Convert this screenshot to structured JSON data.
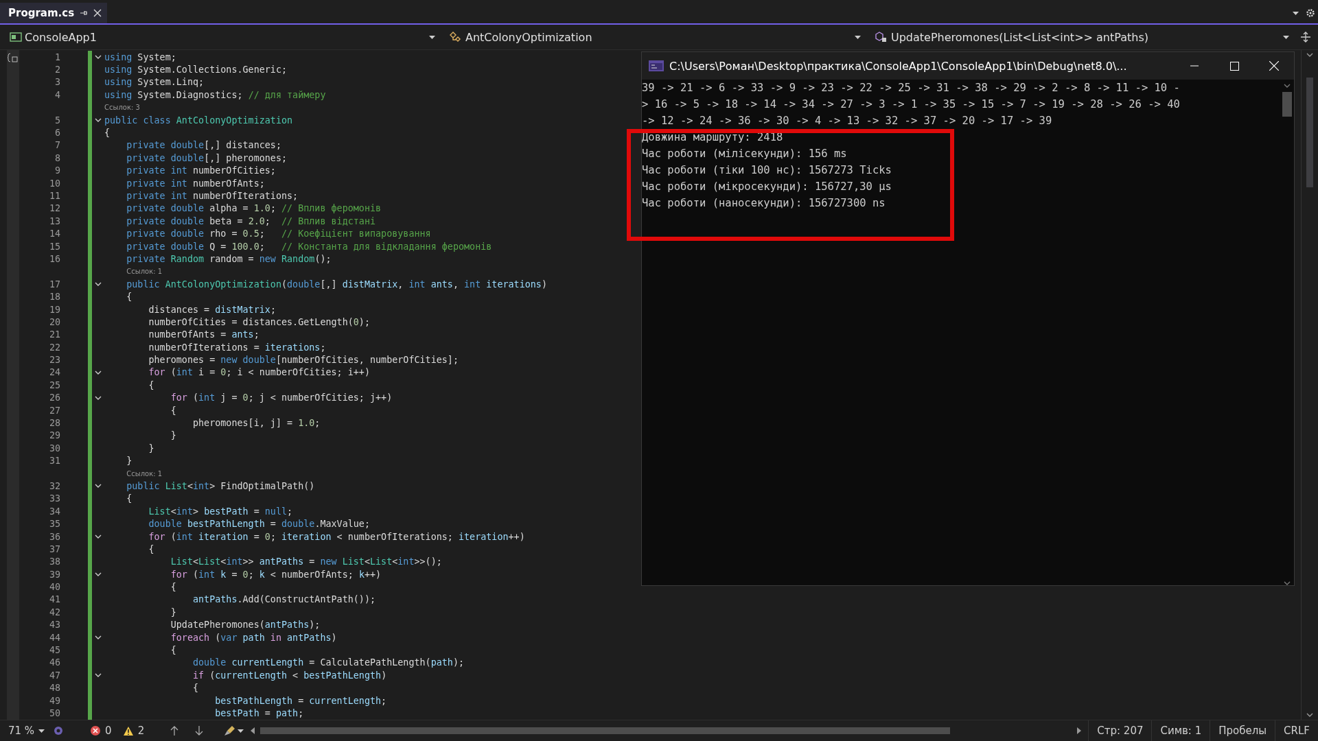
{
  "tab": {
    "title": "Program.cs",
    "selected": true
  },
  "nav": {
    "project": "ConsoleApp1",
    "type": "AntColonyOptimization",
    "member": "UpdatePheromones(List<List<int>> antPaths)"
  },
  "code": [
    {
      "kind": "code",
      "num": "1",
      "fold": true,
      "t": [
        {
          "kind": "k",
          "text": "using"
        },
        {
          "kind": "p",
          "text": " System;"
        }
      ]
    },
    {
      "kind": "code",
      "num": "2",
      "fold": false,
      "t": [
        {
          "kind": "k",
          "text": "using"
        },
        {
          "kind": "p",
          "text": " System.Collections.Generic;"
        }
      ]
    },
    {
      "kind": "code",
      "num": "3",
      "fold": false,
      "t": [
        {
          "kind": "k",
          "text": "using"
        },
        {
          "kind": "p",
          "text": " System.Linq;"
        }
      ]
    },
    {
      "kind": "code",
      "num": "4",
      "fold": false,
      "t": [
        {
          "kind": "k",
          "text": "using"
        },
        {
          "kind": "p",
          "text": " System.Diagnostics; "
        },
        {
          "kind": "g",
          "text": "// для таймеру"
        }
      ]
    },
    {
      "kind": "lens",
      "text": "Ссылок: 3"
    },
    {
      "kind": "code",
      "num": "5",
      "fold": true,
      "t": [
        {
          "kind": "k",
          "text": "public class "
        },
        {
          "kind": "t",
          "text": "AntColonyOptimization"
        }
      ]
    },
    {
      "kind": "code",
      "num": "6",
      "fold": false,
      "t": [
        {
          "kind": "p",
          "text": "{"
        }
      ]
    },
    {
      "kind": "code",
      "num": "7",
      "fold": false,
      "t": [
        {
          "kind": "k",
          "text": "    private double"
        },
        {
          "kind": "p",
          "text": "[,] distances;"
        }
      ]
    },
    {
      "kind": "code",
      "num": "8",
      "fold": false,
      "t": [
        {
          "kind": "k",
          "text": "    private double"
        },
        {
          "kind": "p",
          "text": "[,] pheromones;"
        }
      ]
    },
    {
      "kind": "code",
      "num": "9",
      "fold": false,
      "t": [
        {
          "kind": "k",
          "text": "    private int"
        },
        {
          "kind": "p",
          "text": " numberOfCities;"
        }
      ]
    },
    {
      "kind": "code",
      "num": "10",
      "fold": false,
      "t": [
        {
          "kind": "k",
          "text": "    private int"
        },
        {
          "kind": "p",
          "text": " numberOfAnts;"
        }
      ]
    },
    {
      "kind": "code",
      "num": "11",
      "fold": false,
      "t": [
        {
          "kind": "k",
          "text": "    private int"
        },
        {
          "kind": "p",
          "text": " numberOfIterations;"
        }
      ]
    },
    {
      "kind": "code",
      "num": "12",
      "fold": false,
      "t": [
        {
          "kind": "k",
          "text": "    private double"
        },
        {
          "kind": "p",
          "text": " alpha = "
        },
        {
          "kind": "n",
          "text": "1.0"
        },
        {
          "kind": "p",
          "text": "; "
        },
        {
          "kind": "g",
          "text": "// Вплив феромонів"
        }
      ]
    },
    {
      "kind": "code",
      "num": "13",
      "fold": false,
      "t": [
        {
          "kind": "k",
          "text": "    private double"
        },
        {
          "kind": "p",
          "text": " beta = "
        },
        {
          "kind": "n",
          "text": "2.0"
        },
        {
          "kind": "p",
          "text": ";  "
        },
        {
          "kind": "g",
          "text": "// Вплив відстані"
        }
      ]
    },
    {
      "kind": "code",
      "num": "14",
      "fold": false,
      "t": [
        {
          "kind": "k",
          "text": "    private double"
        },
        {
          "kind": "p",
          "text": " rho = "
        },
        {
          "kind": "n",
          "text": "0.5"
        },
        {
          "kind": "p",
          "text": ";   "
        },
        {
          "kind": "g",
          "text": "// Коефіцієнт випаровування"
        }
      ]
    },
    {
      "kind": "code",
      "num": "15",
      "fold": false,
      "t": [
        {
          "kind": "k",
          "text": "    private double"
        },
        {
          "kind": "p",
          "text": " Q = "
        },
        {
          "kind": "n",
          "text": "100.0"
        },
        {
          "kind": "p",
          "text": ";   "
        },
        {
          "kind": "g",
          "text": "// Константа для відкладання феромонів"
        }
      ]
    },
    {
      "kind": "code",
      "num": "16",
      "fold": false,
      "t": [
        {
          "kind": "k",
          "text": "    private "
        },
        {
          "kind": "t",
          "text": "Random"
        },
        {
          "kind": "p",
          "text": " random = "
        },
        {
          "kind": "k",
          "text": "new "
        },
        {
          "kind": "t",
          "text": "Random"
        },
        {
          "kind": "p",
          "text": "();"
        }
      ]
    },
    {
      "kind": "lens",
      "text": "Ссылок: 1"
    },
    {
      "kind": "code",
      "num": "17",
      "fold": true,
      "t": [
        {
          "kind": "k",
          "text": "    public "
        },
        {
          "kind": "t",
          "text": "AntColonyOptimization"
        },
        {
          "kind": "p",
          "text": "("
        },
        {
          "kind": "k",
          "text": "double"
        },
        {
          "kind": "p",
          "text": "[,] "
        },
        {
          "kind": "v",
          "text": "distMatrix"
        },
        {
          "kind": "p",
          "text": ", "
        },
        {
          "kind": "k",
          "text": "int "
        },
        {
          "kind": "v",
          "text": "ants"
        },
        {
          "kind": "p",
          "text": ", "
        },
        {
          "kind": "k",
          "text": "int "
        },
        {
          "kind": "v",
          "text": "iterations"
        },
        {
          "kind": "p",
          "text": ")"
        }
      ]
    },
    {
      "kind": "code",
      "num": "18",
      "fold": false,
      "t": [
        {
          "kind": "p",
          "text": "    {"
        }
      ]
    },
    {
      "kind": "code",
      "num": "19",
      "fold": false,
      "t": [
        {
          "kind": "p",
          "text": "        distances = "
        },
        {
          "kind": "v",
          "text": "distMatrix"
        },
        {
          "kind": "p",
          "text": ";"
        }
      ]
    },
    {
      "kind": "code",
      "num": "20",
      "fold": false,
      "t": [
        {
          "kind": "p",
          "text": "        numberOfCities = distances.GetLength("
        },
        {
          "kind": "n",
          "text": "0"
        },
        {
          "kind": "p",
          "text": ");"
        }
      ]
    },
    {
      "kind": "code",
      "num": "21",
      "fold": false,
      "t": [
        {
          "kind": "p",
          "text": "        numberOfAnts = "
        },
        {
          "kind": "v",
          "text": "ants"
        },
        {
          "kind": "p",
          "text": ";"
        }
      ]
    },
    {
      "kind": "code",
      "num": "22",
      "fold": false,
      "t": [
        {
          "kind": "p",
          "text": "        numberOfIterations = "
        },
        {
          "kind": "v",
          "text": "iterations"
        },
        {
          "kind": "p",
          "text": ";"
        }
      ]
    },
    {
      "kind": "code",
      "num": "23",
      "fold": false,
      "t": [
        {
          "kind": "p",
          "text": "        pheromones = "
        },
        {
          "kind": "k",
          "text": "new double"
        },
        {
          "kind": "p",
          "text": "[numberOfCities, numberOfCities];"
        }
      ]
    },
    {
      "kind": "code",
      "num": "24",
      "fold": true,
      "t": [
        {
          "kind": "c",
          "text": "        for"
        },
        {
          "kind": "p",
          "text": " ("
        },
        {
          "kind": "k",
          "text": "int"
        },
        {
          "kind": "p",
          "text": " i = "
        },
        {
          "kind": "n",
          "text": "0"
        },
        {
          "kind": "p",
          "text": "; i < numberOfCities; i++)"
        }
      ]
    },
    {
      "kind": "code",
      "num": "25",
      "fold": false,
      "t": [
        {
          "kind": "p",
          "text": "        {"
        }
      ]
    },
    {
      "kind": "code",
      "num": "26",
      "fold": true,
      "t": [
        {
          "kind": "c",
          "text": "            for"
        },
        {
          "kind": "p",
          "text": " ("
        },
        {
          "kind": "k",
          "text": "int"
        },
        {
          "kind": "p",
          "text": " j = "
        },
        {
          "kind": "n",
          "text": "0"
        },
        {
          "kind": "p",
          "text": "; j < numberOfCities; j++)"
        }
      ]
    },
    {
      "kind": "code",
      "num": "27",
      "fold": false,
      "t": [
        {
          "kind": "p",
          "text": "            {"
        }
      ]
    },
    {
      "kind": "code",
      "num": "28",
      "fold": false,
      "t": [
        {
          "kind": "p",
          "text": "                pheromones[i, j] = "
        },
        {
          "kind": "n",
          "text": "1.0"
        },
        {
          "kind": "p",
          "text": ";"
        }
      ]
    },
    {
      "kind": "code",
      "num": "29",
      "fold": false,
      "t": [
        {
          "kind": "p",
          "text": "            }"
        }
      ]
    },
    {
      "kind": "code",
      "num": "30",
      "fold": false,
      "t": [
        {
          "kind": "p",
          "text": "        }"
        }
      ]
    },
    {
      "kind": "code",
      "num": "31",
      "fold": false,
      "t": [
        {
          "kind": "p",
          "text": "    }"
        }
      ]
    },
    {
      "kind": "lens",
      "text": "Ссылок: 1"
    },
    {
      "kind": "code",
      "num": "32",
      "fold": true,
      "t": [
        {
          "kind": "k",
          "text": "    public "
        },
        {
          "kind": "t",
          "text": "List"
        },
        {
          "kind": "p",
          "text": "<"
        },
        {
          "kind": "k",
          "text": "int"
        },
        {
          "kind": "p",
          "text": "> FindOptimalPath()"
        }
      ]
    },
    {
      "kind": "code",
      "num": "33",
      "fold": false,
      "t": [
        {
          "kind": "p",
          "text": "    {"
        }
      ]
    },
    {
      "kind": "code",
      "num": "34",
      "fold": false,
      "t": [
        {
          "kind": "t",
          "text": "        List"
        },
        {
          "kind": "p",
          "text": "<"
        },
        {
          "kind": "k",
          "text": "int"
        },
        {
          "kind": "p",
          "text": "> "
        },
        {
          "kind": "v",
          "text": "bestPath"
        },
        {
          "kind": "p",
          "text": " = "
        },
        {
          "kind": "k",
          "text": "null"
        },
        {
          "kind": "p",
          "text": ";"
        }
      ]
    },
    {
      "kind": "code",
      "num": "35",
      "fold": false,
      "t": [
        {
          "kind": "k",
          "text": "        double "
        },
        {
          "kind": "v",
          "text": "bestPathLength"
        },
        {
          "kind": "p",
          "text": " = "
        },
        {
          "kind": "k",
          "text": "double"
        },
        {
          "kind": "p",
          "text": ".MaxValue;"
        }
      ]
    },
    {
      "kind": "code",
      "num": "36",
      "fold": true,
      "t": [
        {
          "kind": "c",
          "text": "        for"
        },
        {
          "kind": "p",
          "text": " ("
        },
        {
          "kind": "k",
          "text": "int "
        },
        {
          "kind": "v",
          "text": "iteration"
        },
        {
          "kind": "p",
          "text": " = "
        },
        {
          "kind": "n",
          "text": "0"
        },
        {
          "kind": "p",
          "text": "; "
        },
        {
          "kind": "v",
          "text": "iteration"
        },
        {
          "kind": "p",
          "text": " < numberOfIterations; "
        },
        {
          "kind": "v",
          "text": "iteration"
        },
        {
          "kind": "p",
          "text": "++)"
        }
      ]
    },
    {
      "kind": "code",
      "num": "37",
      "fold": false,
      "t": [
        {
          "kind": "p",
          "text": "        {"
        }
      ]
    },
    {
      "kind": "code",
      "num": "38",
      "fold": false,
      "t": [
        {
          "kind": "t",
          "text": "            List"
        },
        {
          "kind": "p",
          "text": "<"
        },
        {
          "kind": "t",
          "text": "List"
        },
        {
          "kind": "p",
          "text": "<"
        },
        {
          "kind": "k",
          "text": "int"
        },
        {
          "kind": "p",
          "text": ">> "
        },
        {
          "kind": "v",
          "text": "antPaths"
        },
        {
          "kind": "p",
          "text": " = "
        },
        {
          "kind": "k",
          "text": "new "
        },
        {
          "kind": "t",
          "text": "List"
        },
        {
          "kind": "p",
          "text": "<"
        },
        {
          "kind": "t",
          "text": "List"
        },
        {
          "kind": "p",
          "text": "<"
        },
        {
          "kind": "k",
          "text": "int"
        },
        {
          "kind": "p",
          "text": ">>();"
        }
      ]
    },
    {
      "kind": "code",
      "num": "39",
      "fold": true,
      "t": [
        {
          "kind": "c",
          "text": "            for"
        },
        {
          "kind": "p",
          "text": " ("
        },
        {
          "kind": "k",
          "text": "int "
        },
        {
          "kind": "v",
          "text": "k"
        },
        {
          "kind": "p",
          "text": " = "
        },
        {
          "kind": "n",
          "text": "0"
        },
        {
          "kind": "p",
          "text": "; "
        },
        {
          "kind": "v",
          "text": "k"
        },
        {
          "kind": "p",
          "text": " < numberOfAnts; "
        },
        {
          "kind": "v",
          "text": "k"
        },
        {
          "kind": "p",
          "text": "++)"
        }
      ]
    },
    {
      "kind": "code",
      "num": "40",
      "fold": false,
      "t": [
        {
          "kind": "p",
          "text": "            {"
        }
      ]
    },
    {
      "kind": "code",
      "num": "41",
      "fold": false,
      "t": [
        {
          "kind": "v",
          "text": "                antPaths"
        },
        {
          "kind": "p",
          "text": ".Add(ConstructAntPath());"
        }
      ]
    },
    {
      "kind": "code",
      "num": "42",
      "fold": false,
      "t": [
        {
          "kind": "p",
          "text": "            }"
        }
      ]
    },
    {
      "kind": "code",
      "num": "43",
      "fold": false,
      "t": [
        {
          "kind": "p",
          "text": "            UpdatePheromones("
        },
        {
          "kind": "v",
          "text": "antPaths"
        },
        {
          "kind": "p",
          "text": ");"
        }
      ]
    },
    {
      "kind": "code",
      "num": "44",
      "fold": true,
      "t": [
        {
          "kind": "c",
          "text": "            foreach"
        },
        {
          "kind": "p",
          "text": " ("
        },
        {
          "kind": "k",
          "text": "var "
        },
        {
          "kind": "v",
          "text": "path"
        },
        {
          "kind": "c",
          "text": " in "
        },
        {
          "kind": "v",
          "text": "antPaths"
        },
        {
          "kind": "p",
          "text": ")"
        }
      ]
    },
    {
      "kind": "code",
      "num": "45",
      "fold": false,
      "t": [
        {
          "kind": "p",
          "text": "            {"
        }
      ]
    },
    {
      "kind": "code",
      "num": "46",
      "fold": false,
      "t": [
        {
          "kind": "k",
          "text": "                double "
        },
        {
          "kind": "v",
          "text": "currentLength"
        },
        {
          "kind": "p",
          "text": " = CalculatePathLength("
        },
        {
          "kind": "v",
          "text": "path"
        },
        {
          "kind": "p",
          "text": ");"
        }
      ]
    },
    {
      "kind": "code",
      "num": "47",
      "fold": true,
      "t": [
        {
          "kind": "c",
          "text": "                if"
        },
        {
          "kind": "p",
          "text": " ("
        },
        {
          "kind": "v",
          "text": "currentLength"
        },
        {
          "kind": "p",
          "text": " < "
        },
        {
          "kind": "v",
          "text": "bestPathLength"
        },
        {
          "kind": "p",
          "text": ")"
        }
      ]
    },
    {
      "kind": "code",
      "num": "48",
      "fold": false,
      "t": [
        {
          "kind": "p",
          "text": "                {"
        }
      ]
    },
    {
      "kind": "code",
      "num": "49",
      "fold": false,
      "t": [
        {
          "kind": "v",
          "text": "                    bestPathLength"
        },
        {
          "kind": "p",
          "text": " = "
        },
        {
          "kind": "v",
          "text": "currentLength"
        },
        {
          "kind": "p",
          "text": ";"
        }
      ]
    },
    {
      "kind": "code",
      "num": "50",
      "fold": false,
      "t": [
        {
          "kind": "v",
          "text": "                    bestPath"
        },
        {
          "kind": "p",
          "text": " = "
        },
        {
          "kind": "v",
          "text": "path"
        },
        {
          "kind": "p",
          "text": ";"
        }
      ]
    }
  ],
  "console": {
    "title": "C:\\Users\\Роман\\Desktop\\практика\\ConsoleApp1\\ConsoleApp1\\bin\\Debug\\net8.0\\...",
    "lines": [
      "39 -> 21 -> 6 -> 33 -> 9 -> 23 -> 22 -> 25 -> 31 -> 38 -> 29 -> 2 -> 8 -> 11 -> 10 -",
      "> 16 -> 5 -> 18 -> 14 -> 34 -> 27 -> 3 -> 1 -> 35 -> 15 -> 7 -> 19 -> 28 -> 26 -> 40",
      "-> 12 -> 24 -> 36 -> 30 -> 4 -> 13 -> 32 -> 37 -> 20 -> 17 -> 39",
      "Довжина маршруту: 2418",
      "Час роботи (мілісекунди): 156 ms",
      "Час роботи (тіки 100 нс): 1567273 Ticks",
      "Час роботи (мікросекунди): 156727,30 µs",
      "Час роботи (наносекунди): 156727300 ns"
    ]
  },
  "status": {
    "zoom": "71 %",
    "errors": "0",
    "warnings": "2",
    "line": "Стр: 207",
    "col": "Симв: 1",
    "indent": "Пробелы",
    "eol": "CRLF"
  }
}
